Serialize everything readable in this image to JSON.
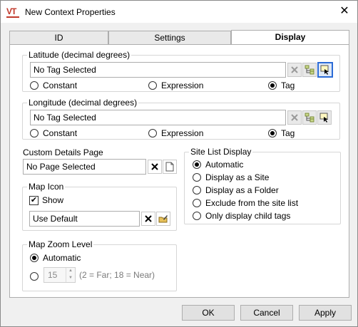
{
  "window": {
    "title": "New Context Properties",
    "app_icon_text": "VT"
  },
  "tabs": [
    {
      "label": "ID"
    },
    {
      "label": "Settings"
    },
    {
      "label": "Display"
    }
  ],
  "latitude": {
    "label": "Latitude (decimal degrees)",
    "value": "No Tag Selected",
    "options": [
      "Constant",
      "Expression",
      "Tag"
    ],
    "selected": "Tag"
  },
  "longitude": {
    "label": "Longitude (decimal degrees)",
    "value": "No Tag Selected",
    "options": [
      "Constant",
      "Expression",
      "Tag"
    ],
    "selected": "Tag"
  },
  "custom_details": {
    "label": "Custom Details Page",
    "value": "No Page Selected"
  },
  "map_icon": {
    "label": "Map Icon",
    "show_label": "Show",
    "show_checked": true,
    "value": "Use Default"
  },
  "map_zoom": {
    "label": "Map Zoom Level",
    "automatic_label": "Automatic",
    "zoom_value": "15",
    "hint": "(2 = Far;  18 = Near)"
  },
  "site_list": {
    "label": "Site List Display",
    "options": [
      "Automatic",
      "Display as a Site",
      "Display as a Folder",
      "Exclude from the site list",
      "Only display child tags"
    ],
    "selected_index": 0
  },
  "buttons": {
    "ok": "OK",
    "cancel": "Cancel",
    "apply": "Apply"
  },
  "icons": {
    "clear": "x-icon",
    "tag_tree": "tag-tree-icon",
    "tag_select": "tag-select-icon",
    "page": "page-icon",
    "icon_edit": "folder-edit-icon"
  }
}
